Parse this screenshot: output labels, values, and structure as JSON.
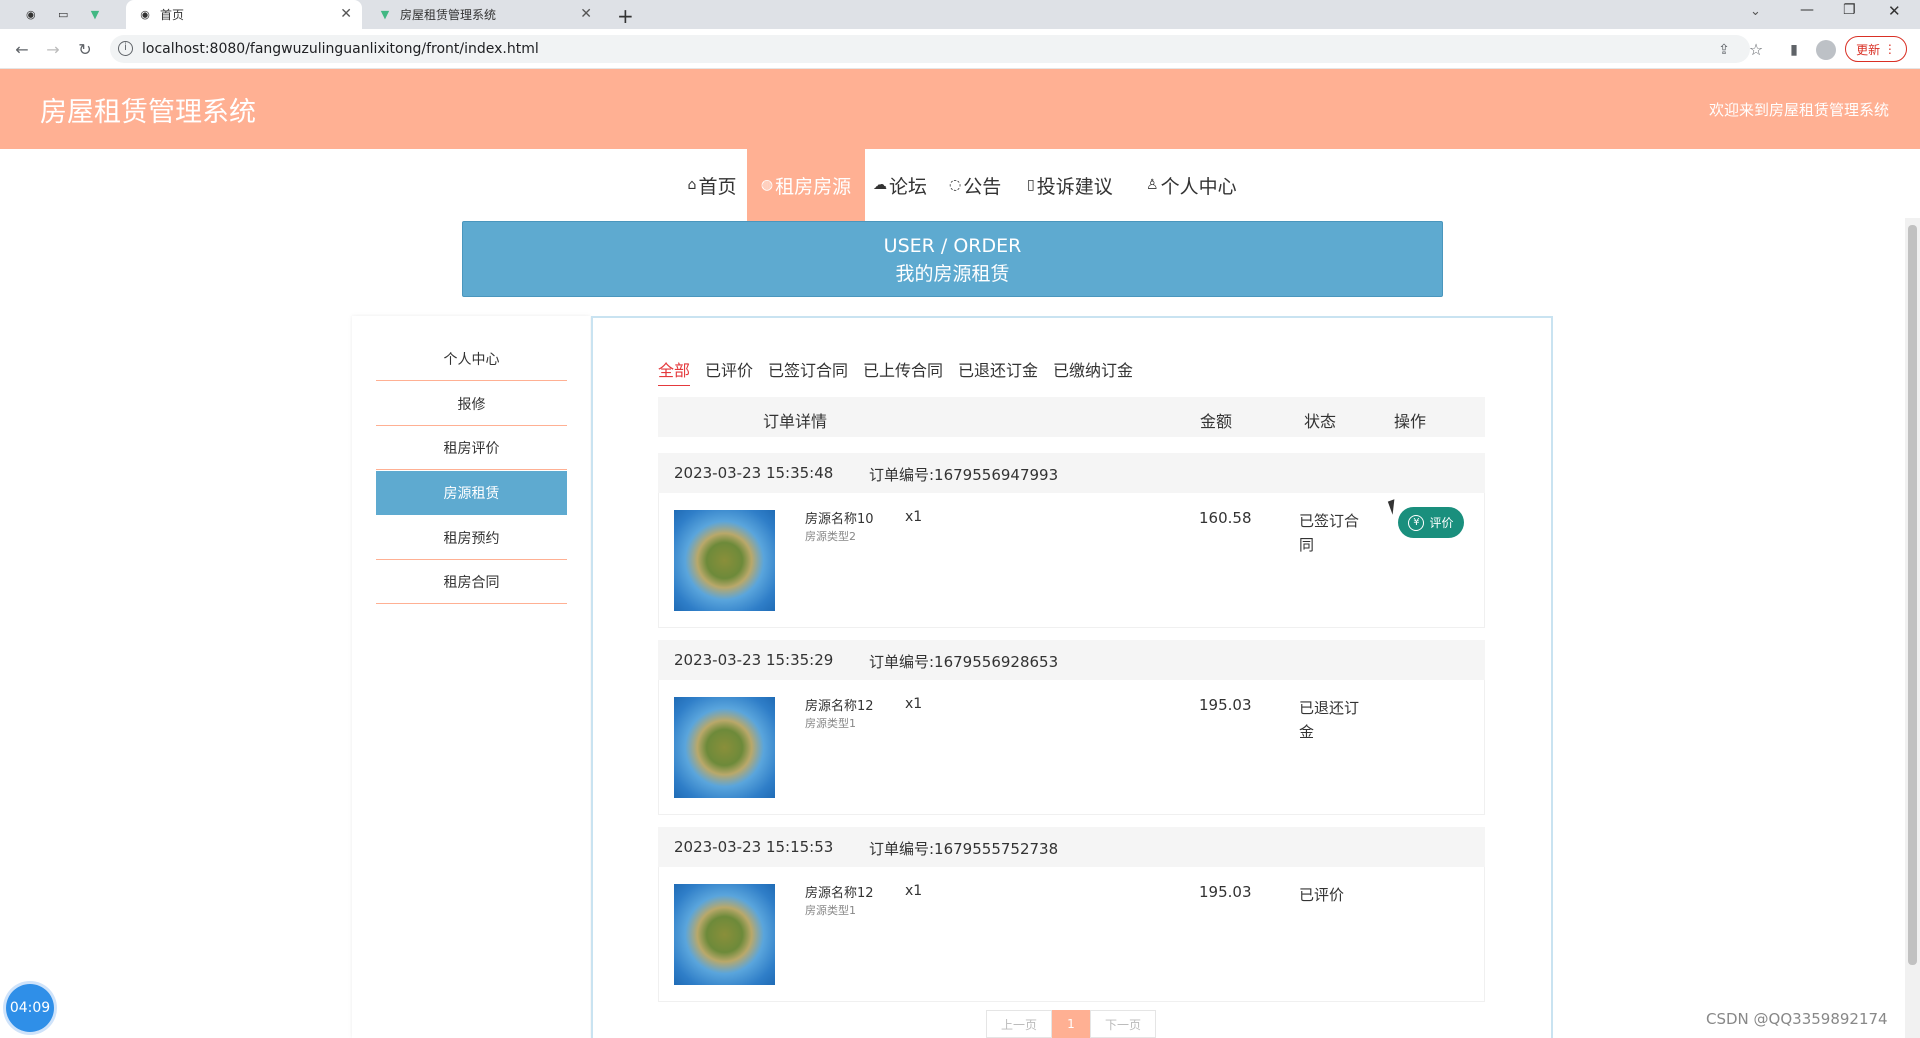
{
  "browser": {
    "tabs": [
      {
        "icon": "globe-icon",
        "title": ""
      },
      {
        "icon": "blank-page-icon",
        "title": ""
      },
      {
        "icon": "vue-logo-icon",
        "title": ""
      },
      {
        "icon": "globe-icon",
        "title": "首页"
      },
      {
        "icon": "vue-logo-icon",
        "title": "房屋租赁管理系统"
      }
    ],
    "new_tab": "+",
    "url": "localhost:8080/fangwuzulinguanlixitong/front/index.html",
    "update_label": "更新"
  },
  "header": {
    "title": "房屋租赁管理系统",
    "welcome": "欢迎来到房屋租赁管理系统",
    "bg_color": "#ffb093"
  },
  "nav": [
    {
      "icon": "home-icon",
      "label": "首页",
      "active": false
    },
    {
      "icon": "house-icon",
      "label": "租房房源",
      "active": true
    },
    {
      "icon": "forum-icon",
      "label": "论坛",
      "active": false
    },
    {
      "icon": "notice-icon",
      "label": "公告",
      "active": false
    },
    {
      "icon": "complaint-icon",
      "label": "投诉建议",
      "active": false
    },
    {
      "icon": "user-icon",
      "label": "个人中心",
      "active": false
    }
  ],
  "banner": {
    "en": "USER / ORDER",
    "cn": "我的房源租赁",
    "color": "#5eaad0"
  },
  "sidebar": [
    {
      "label": "个人中心",
      "active": false
    },
    {
      "label": "报修",
      "active": false
    },
    {
      "label": "租房评价",
      "active": false
    },
    {
      "label": "房源租赁",
      "active": true
    },
    {
      "label": "租房预约",
      "active": false
    },
    {
      "label": "租房合同",
      "active": false
    }
  ],
  "filter_tabs": [
    {
      "label": "全部",
      "active": true
    },
    {
      "label": "已评价",
      "active": false
    },
    {
      "label": "已签订合同",
      "active": false
    },
    {
      "label": "已上传合同",
      "active": false
    },
    {
      "label": "已退还订金",
      "active": false
    },
    {
      "label": "已缴纳订金",
      "active": false
    }
  ],
  "table_header": {
    "detail": "订单详情",
    "amount": "金额",
    "status": "状态",
    "action": "操作"
  },
  "orders": [
    {
      "time": "2023-03-23 15:35:48",
      "order_no": "订单编号:1679556947993",
      "name": "房源名称10",
      "type": "房源类型2",
      "qty": "x1",
      "price": "160.58",
      "status": "已签订合同",
      "action": "评价"
    },
    {
      "time": "2023-03-23 15:35:29",
      "order_no": "订单编号:1679556928653",
      "name": "房源名称12",
      "type": "房源类型1",
      "qty": "x1",
      "price": "195.03",
      "status": "已退还订金",
      "action": ""
    },
    {
      "time": "2023-03-23 15:15:53",
      "order_no": "订单编号:1679555752738",
      "name": "房源名称12",
      "type": "房源类型1",
      "qty": "x1",
      "price": "195.03",
      "status": "已评价",
      "action": ""
    }
  ],
  "pagination": {
    "prev": "上一页",
    "current": "1",
    "next": "下一页"
  },
  "overlay": {
    "clock": "04:09",
    "watermark": "CSDN @QQ3359892174"
  },
  "colors": {
    "accent": "#ffb093",
    "blue": "#5eaad0",
    "active_tab": "#e4393c",
    "action_button": "#1a8f7d"
  }
}
